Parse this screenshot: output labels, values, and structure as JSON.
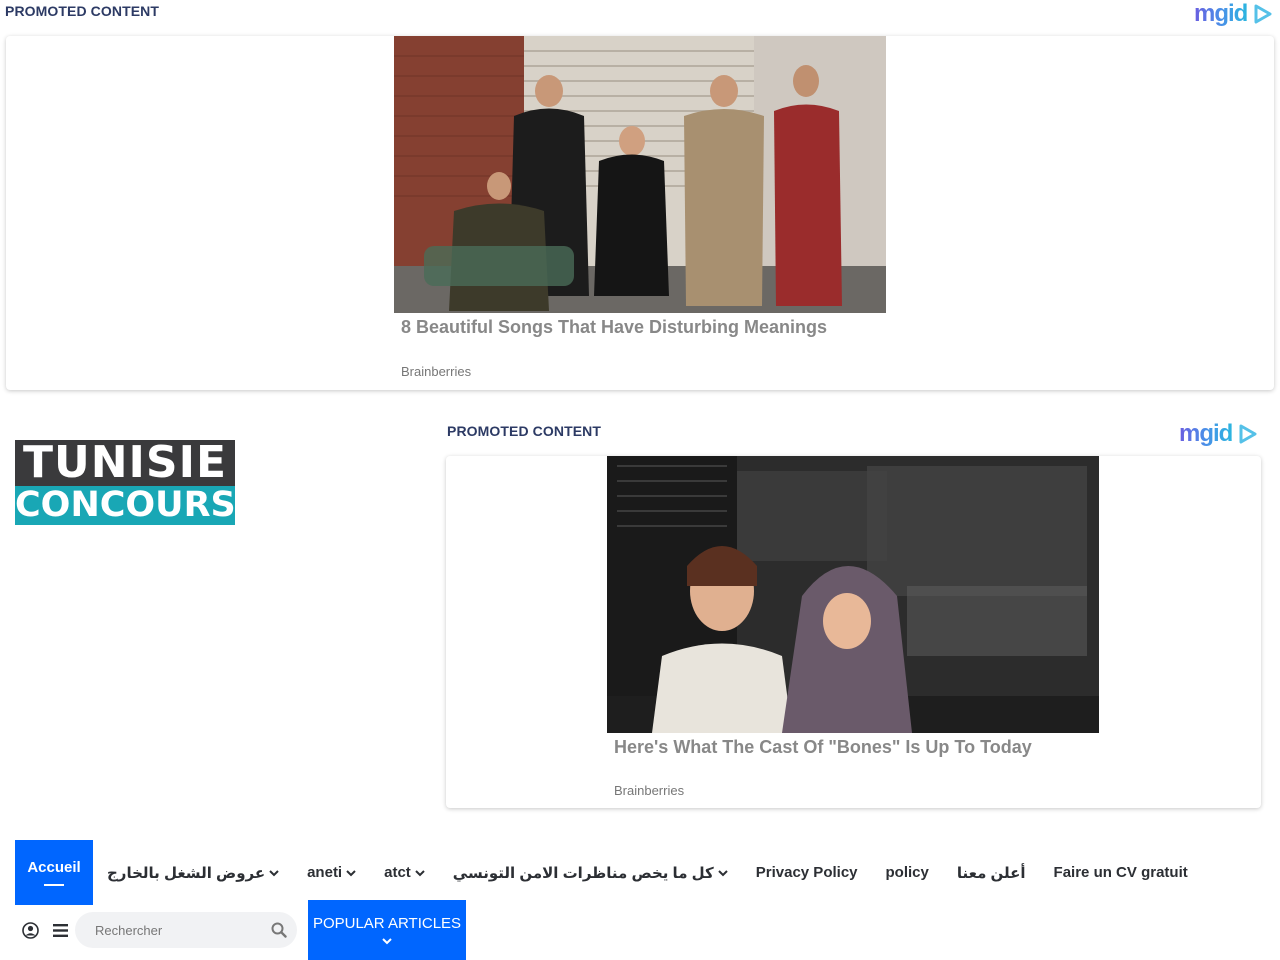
{
  "ads": [
    {
      "promo_label": "PROMOTED CONTENT",
      "brand": "mgid",
      "title": "8 Beautiful Songs That Have Disturbing Meanings",
      "source": "Brainberries"
    },
    {
      "promo_label": "PROMOTED CONTENT",
      "brand": "mgid",
      "title": "Here's What The Cast Of \"Bones\" Is Up To Today",
      "source": "Brainberries"
    }
  ],
  "logo": {
    "line1": "TUNISIE",
    "line2": "CONCOURS"
  },
  "nav": {
    "items": [
      {
        "label": "Accueil",
        "active": true
      },
      {
        "label": "عروض الشغل بالخارج",
        "dropdown": true
      },
      {
        "label": "aneti",
        "dropdown": true
      },
      {
        "label": "atct",
        "dropdown": true
      },
      {
        "label": "كل ما يخص مناظرات الامن التونسي",
        "dropdown": true
      },
      {
        "label": "Privacy Policy"
      },
      {
        "label": "policy"
      },
      {
        "label": "أعلن معنا"
      },
      {
        "label": "Faire un CV gratuit"
      }
    ]
  },
  "search": {
    "placeholder": "Rechercher"
  },
  "popular": {
    "label": "POPULAR ARTICLES"
  },
  "colors": {
    "accent": "#0066ff",
    "promo": "#2c3a64",
    "logo_dark": "#3a3a3c",
    "logo_teal": "#19a7b5"
  },
  "icons": {
    "user": "user-circle-icon",
    "menu": "hamburger-icon",
    "search": "search-icon",
    "chevron": "chevron-down-icon"
  }
}
